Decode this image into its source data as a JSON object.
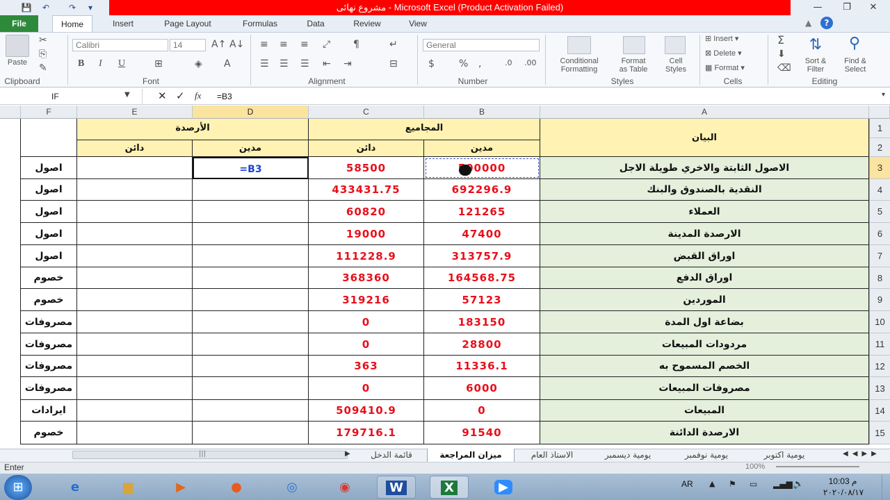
{
  "window": {
    "title": "مشروع نهائى  -  Microsoft Excel (Product Activation Failed)"
  },
  "tabs": [
    "File",
    "Home",
    "Insert",
    "Page Layout",
    "Formulas",
    "Data",
    "Review",
    "View"
  ],
  "ribbon": {
    "paste": "Paste",
    "clipboard": "Clipboard",
    "font_name": "Calibri",
    "font_size": "14",
    "font_group": "Font",
    "alignment_group": "Alignment",
    "number_format": "General",
    "number_group": "Number",
    "conditional_formatting": [
      "Conditional",
      "Formatting"
    ],
    "format_as_table": [
      "Format",
      "as Table"
    ],
    "cell_styles": [
      "Cell",
      "Styles"
    ],
    "styles_group": "Styles",
    "insert": "Insert",
    "delete": "Delete",
    "format": "Format",
    "cells_group": "Cells",
    "sort_filter": [
      "Sort &",
      "Filter"
    ],
    "find_select": [
      "Find &",
      "Select"
    ],
    "editing_group": "Editing",
    "bold": "B",
    "italic": "I",
    "underline": "U",
    "percent": "%"
  },
  "formula_bar": {
    "name_box": "IF",
    "fx": "fx",
    "formula": "=B3"
  },
  "columns": [
    "F",
    "E",
    "D",
    "C",
    "B",
    "A"
  ],
  "row_numbers": [
    "1",
    "2",
    "3",
    "4",
    "5",
    "6",
    "7",
    "8",
    "9",
    "10",
    "11",
    "12",
    "13",
    "14",
    "15"
  ],
  "headers": {
    "balances": "الأرصدة",
    "totals": "المجاميع",
    "statement": "البيان",
    "credit_e": "دائن",
    "debit_d": "مدين",
    "credit_c": "دائن",
    "debit_b": "مدين"
  },
  "rows": [
    {
      "f": "اصول",
      "e": "",
      "d": "=B3",
      "c": "58500",
      "b": "500000",
      "a": "الاصول الثابتة والاخري طويلة الاجل"
    },
    {
      "f": "اصول",
      "e": "",
      "d": "",
      "c": "433431.75",
      "b": "692296.9",
      "a": "النقدية بالصندوق والبنك"
    },
    {
      "f": "اصول",
      "e": "",
      "d": "",
      "c": "60820",
      "b": "121265",
      "a": "العملاء"
    },
    {
      "f": "اصول",
      "e": "",
      "d": "",
      "c": "19000",
      "b": "47400",
      "a": "الارصدة المدينة"
    },
    {
      "f": "اصول",
      "e": "",
      "d": "",
      "c": "111228.9",
      "b": "313757.9",
      "a": "اوراق القبض"
    },
    {
      "f": "خصوم",
      "e": "",
      "d": "",
      "c": "368360",
      "b": "164568.75",
      "a": "اوراق الدفع"
    },
    {
      "f": "خصوم",
      "e": "",
      "d": "",
      "c": "319216",
      "b": "57123",
      "a": "الموردين"
    },
    {
      "f": "مصروفات",
      "e": "",
      "d": "",
      "c": "0",
      "b": "183150",
      "a": "بضاعة اول المدة"
    },
    {
      "f": "مصروفات",
      "e": "",
      "d": "",
      "c": "0",
      "b": "28800",
      "a": "مردودات المبيعات"
    },
    {
      "f": "مصروفات",
      "e": "",
      "d": "",
      "c": "363",
      "b": "11336.1",
      "a": "الخصم المسموح به"
    },
    {
      "f": "مصروفات",
      "e": "",
      "d": "",
      "c": "0",
      "b": "6000",
      "a": "مصروفات المبيعات"
    },
    {
      "f": "ايرادات",
      "e": "",
      "d": "",
      "c": "509410.9",
      "b": "0",
      "a": "المبيعات"
    },
    {
      "f": "خصوم",
      "e": "",
      "d": "",
      "c": "179716.1",
      "b": "91540",
      "a": "الارصدة الدائنة"
    }
  ],
  "sheet_tabs": [
    "قائمة الدخل",
    "ميزان المراجعة",
    "الاستاذ العام",
    "يومية ديسمبر",
    "يومية نوفمبر",
    "يومية اكتوبر"
  ],
  "status": {
    "mode": "Enter",
    "zoom": "100%"
  },
  "tray": {
    "lang": "AR",
    "time": "10:03 م",
    "date": "٢٠٢٠/٠٨/١٧"
  },
  "colors": {
    "file_tab": "#2d8a3b",
    "title_bg": "#ff0000",
    "header_fill": "#fff2b3",
    "label_fill": "#e4efdc",
    "number_text": "#e8101b"
  }
}
